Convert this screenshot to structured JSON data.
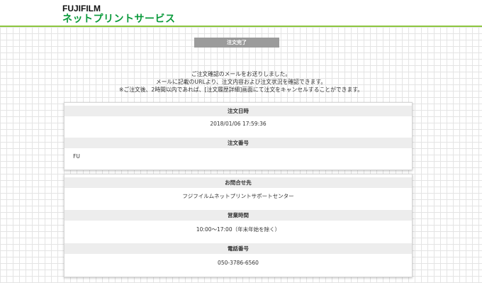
{
  "header": {
    "brand_top": "FUJIFILM",
    "brand_main": "ネットプリントサービス"
  },
  "status": "注文完了",
  "notice": {
    "line1": "ご注文確認のメールをお送りしました。",
    "line2": "メールに記載のURLより、注文内容および注文状況を確認できます。",
    "line3": "※ご注文後、2時間以内であれば、[注文履歴詳細]画面にて注文をキャンセルすることができます。"
  },
  "order": {
    "date_label": "注文日時",
    "date_value": "2018/01/06 17:59:36",
    "number_label": "注文番号",
    "number_value": "FU"
  },
  "contact": {
    "label": "お問合せ先",
    "value": "フジフイルムネットプリントサポートセンター",
    "hours_label": "営業時間",
    "hours_value": "10:00～17:00（年末年始を除く）",
    "phone_label": "電話番号",
    "phone_value": "050-3786-6560"
  },
  "colors": {
    "brand_green": "#0a9a3b",
    "header_rule": "#8cc63f",
    "status_bg": "#9b9b9b"
  }
}
